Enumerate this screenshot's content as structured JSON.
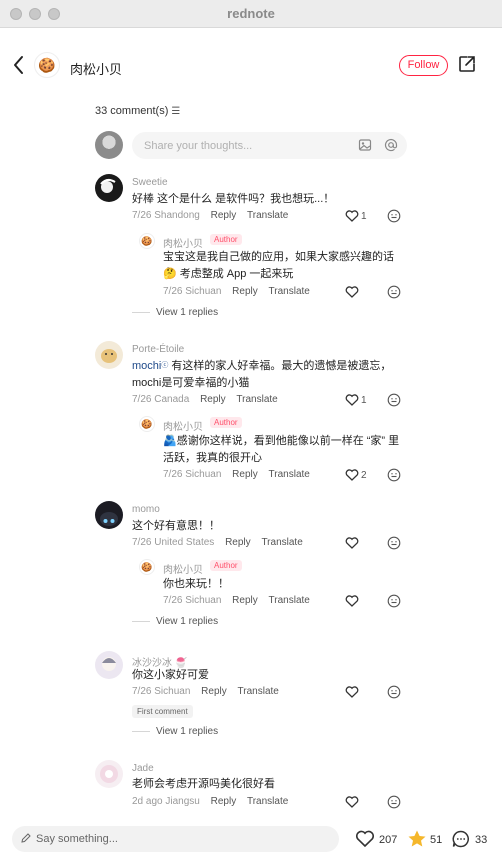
{
  "window": {
    "title": "rednote"
  },
  "header": {
    "author": "肉松小贝",
    "follow_label": "Follow"
  },
  "comments_header": {
    "count_label": "33 comment(s)"
  },
  "input": {
    "placeholder": "Share your thoughts..."
  },
  "comments": [
    {
      "user": "Sweetie",
      "text": "好棒 这个是什么 是软件吗？我也想玩...！",
      "date": "7/26",
      "location": "Shandong",
      "likes": "1",
      "reply": {
        "user": "肉松小贝",
        "badge": "Author",
        "text_line1": "宝宝这是我自己做的应用，如果大家感兴趣的话",
        "text_line2": "🤔 考虑整成 App 一起来玩",
        "date": "7/26",
        "location": "Sichuan"
      },
      "view_replies": "View 1 replies"
    },
    {
      "user": "Porte-Étoile",
      "text_line1_prefix": "mochi",
      "text_line1_rest": " 有这样的家人好幸福。最大的遗憾是被遗忘，",
      "text_line2": "mochi是可爱幸福的小猫",
      "date": "7/26",
      "location": "Canada",
      "likes": "1",
      "reply": {
        "user": "肉松小贝",
        "badge": "Author",
        "text_line1": "🫂感谢你这样说，看到他能像以前一样在 “家” 里",
        "text_line2": "活跃，我真的很开心",
        "date": "7/26",
        "location": "Sichuan",
        "likes": "2"
      }
    },
    {
      "user": "momo",
      "text": "这个好有意思！！",
      "date": "7/26",
      "location": "United States",
      "reply": {
        "user": "肉松小贝",
        "badge": "Author",
        "text": "你也来玩！！",
        "date": "7/26",
        "location": "Sichuan"
      },
      "view_replies": "View 1 replies"
    },
    {
      "user": "冰沙沙冰",
      "text": "你这小家好可爱",
      "date": "7/26",
      "location": "Sichuan",
      "first_badge": "First comment",
      "view_replies": "View 1 replies"
    },
    {
      "user": "Jade",
      "text": "老师会考虑开源吗美化很好看",
      "date": "2d ago",
      "location": "Jiangsu"
    }
  ],
  "actions": {
    "reply": "Reply",
    "translate": "Translate"
  },
  "bottom_bar": {
    "say_placeholder": "Say something...",
    "likes": "207",
    "stars": "51",
    "comments": "33"
  },
  "colors": {
    "accent": "#ff2442",
    "star": "#f5b72b"
  }
}
